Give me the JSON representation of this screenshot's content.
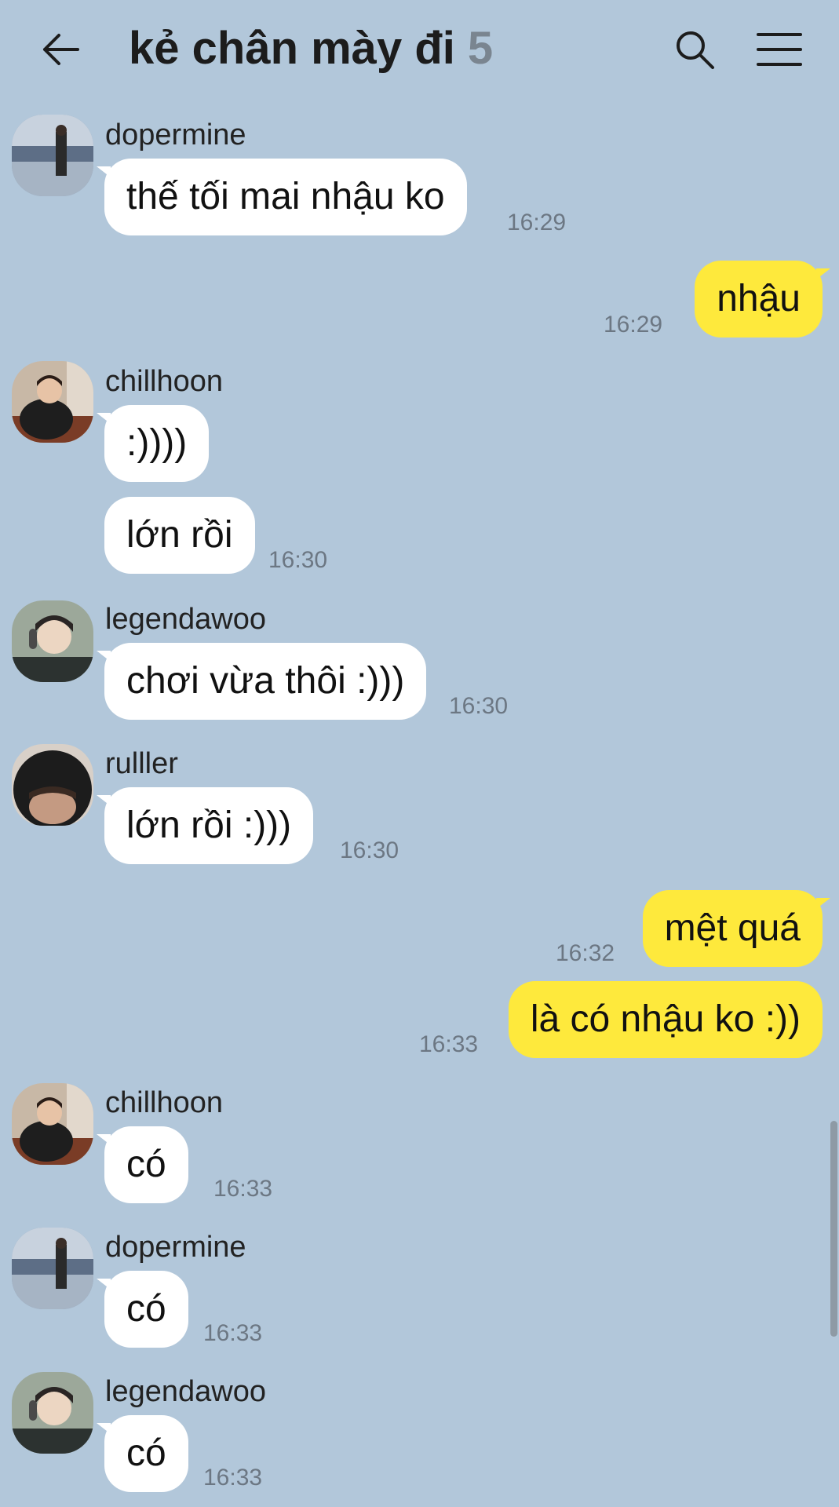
{
  "header": {
    "title": "kẻ chân mày đi",
    "member_count": "5",
    "back_icon": "back-arrow-icon",
    "search_icon": "search-icon",
    "menu_icon": "menu-icon"
  },
  "colors": {
    "background": "#b2c7da",
    "incoming_bubble": "#ffffff",
    "outgoing_bubble": "#fee93c",
    "timestamp": "#6c7783"
  },
  "messages": [
    {
      "sender": "dopermine",
      "text": "thế tối mai nhậu ko",
      "time": "16:29"
    },
    {
      "sender": "me",
      "text": "nhậu",
      "time": "16:29"
    },
    {
      "sender": "chillhoon",
      "text": ":))))",
      "time": ""
    },
    {
      "sender": "chillhoon",
      "text": "lớn rồi",
      "time": "16:30"
    },
    {
      "sender": "legendawoo",
      "text": "chơi vừa thôi :)))",
      "time": "16:30"
    },
    {
      "sender": "rulller",
      "text": "lớn rồi :)))",
      "time": "16:30"
    },
    {
      "sender": "me",
      "text": "mệt quá",
      "time": "16:32"
    },
    {
      "sender": "me",
      "text": "là có nhậu ko :))",
      "time": "16:33"
    },
    {
      "sender": "chillhoon",
      "text": "có",
      "time": "16:33"
    },
    {
      "sender": "dopermine",
      "text": "có",
      "time": "16:33"
    },
    {
      "sender": "legendawoo",
      "text": "có",
      "time": "16:33"
    }
  ]
}
